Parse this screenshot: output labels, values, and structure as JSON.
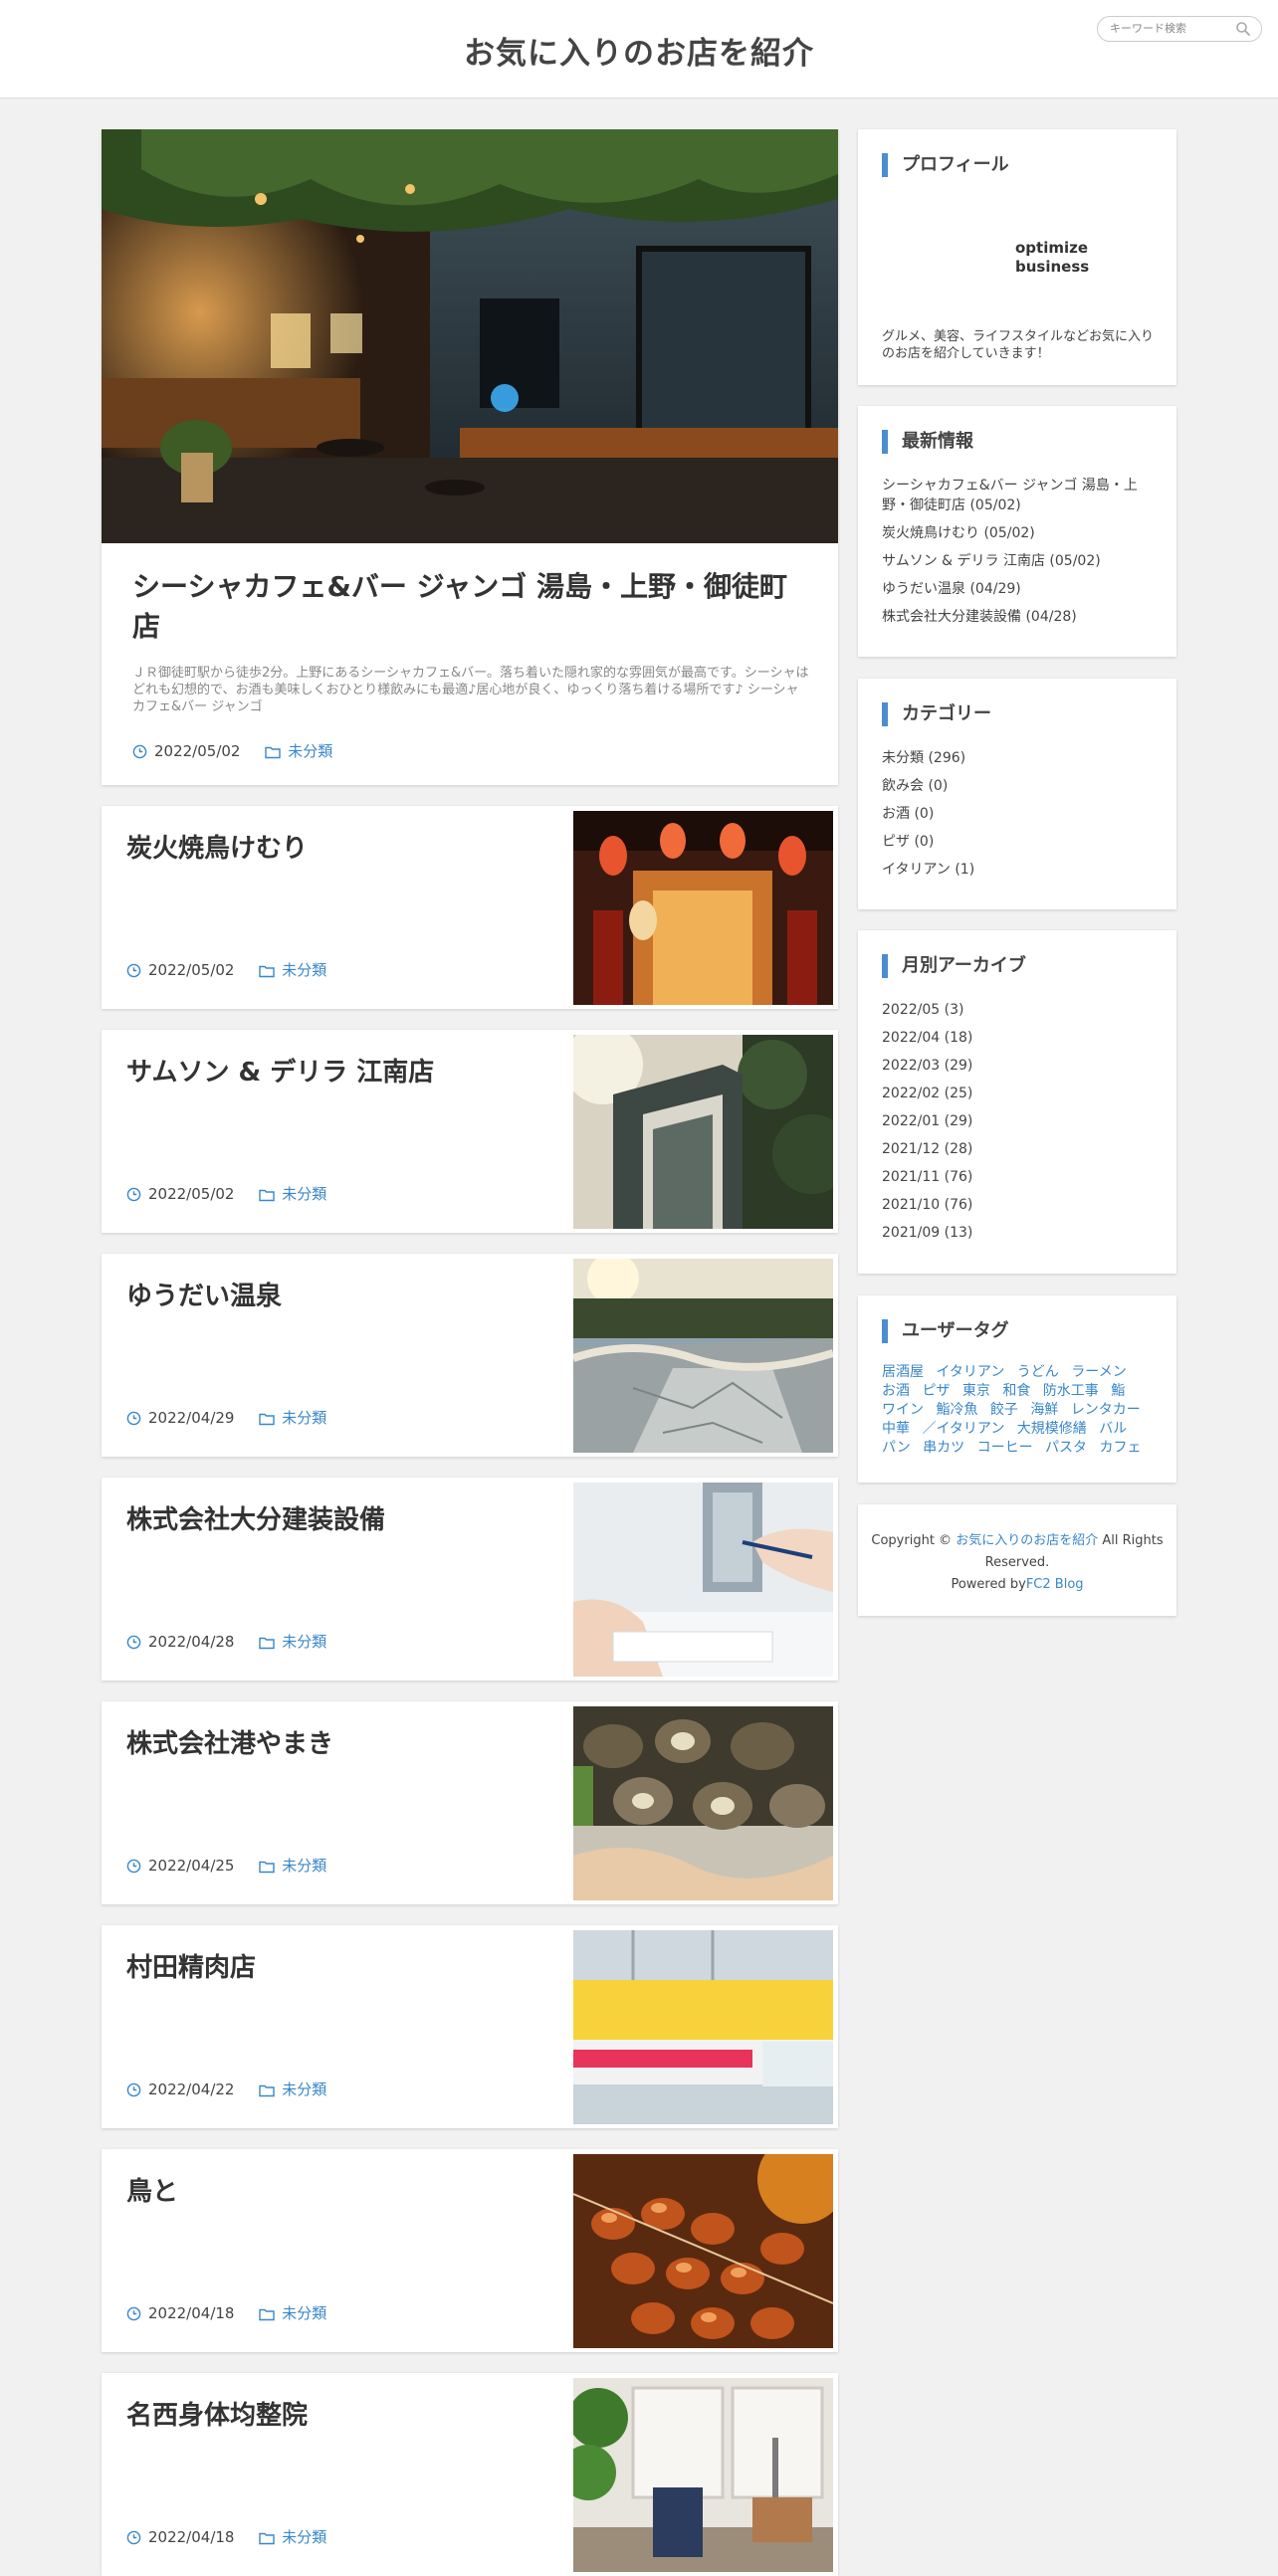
{
  "site": {
    "title": "お気に入りのお店を紹介"
  },
  "search": {
    "placeholder": "キーワード検索"
  },
  "featured": {
    "title": "シーシャカフェ&バー ジャンゴ 湯島・上野・御徒町店",
    "excerpt": "ＪＲ御徒町駅から徒歩2分。上野にあるシーシャカフェ&バー。落ち着いた隠れ家的な雰囲気が最高です。シーシャはどれも幻想的で、お酒も美味しくおひとり様飲みにも最適♪居心地が良く、ゆっくり落ち着ける場所です♪ シーシャカフェ&バー ジャンゴ",
    "date": "2022/05/02",
    "category": "未分類"
  },
  "posts": [
    {
      "title": "炭火焼鳥けむり",
      "date": "2022/05/02",
      "category": "未分類"
    },
    {
      "title": "サムソン & デリラ 江南店",
      "date": "2022/05/02",
      "category": "未分類"
    },
    {
      "title": "ゆうだい温泉",
      "date": "2022/04/29",
      "category": "未分類"
    },
    {
      "title": "株式会社大分建装設備",
      "date": "2022/04/28",
      "category": "未分類"
    },
    {
      "title": "株式会社港やまき",
      "date": "2022/04/25",
      "category": "未分類"
    },
    {
      "title": "村田精肉店",
      "date": "2022/04/22",
      "category": "未分類"
    },
    {
      "title": "鳥と",
      "date": "2022/04/18",
      "category": "未分類"
    },
    {
      "title": "名西身体均整院",
      "date": "2022/04/18",
      "category": "未分類"
    }
  ],
  "sidebar": {
    "profile": {
      "title": "プロフィール",
      "name": "optimize business",
      "description": "グルメ、美容、ライフスタイルなどお気に入りのお店を紹介していきます！"
    },
    "recent": {
      "title": "最新情報",
      "items": [
        "シーシャカフェ&バー ジャンゴ 湯島・上野・御徒町店 (05/02)",
        "炭火焼鳥けむり (05/02)",
        "サムソン & デリラ 江南店 (05/02)",
        "ゆうだい温泉 (04/29)",
        "株式会社大分建装設備 (04/28)"
      ]
    },
    "categories": {
      "title": "カテゴリー",
      "items": [
        "未分類 (296)",
        "飲み会 (0)",
        "お酒 (0)",
        "ピザ (0)",
        "イタリアン (1)"
      ]
    },
    "archives": {
      "title": "月別アーカイブ",
      "items": [
        "2022/05 (3)",
        "2022/04 (18)",
        "2022/03 (29)",
        "2022/02 (25)",
        "2022/01 (29)",
        "2021/12 (28)",
        "2021/11 (76)",
        "2021/10 (76)",
        "2021/09 (13)"
      ]
    },
    "tags": {
      "title": "ユーザータグ",
      "items": [
        "居酒屋",
        "イタリアン",
        "うどん",
        "ラーメン",
        "お酒",
        "ピザ",
        "東京",
        "和食",
        "防水工事",
        "鮨",
        "ワイン",
        "鮨冷魚",
        "餃子",
        "海鮮",
        "レンタカー",
        "中華",
        "／イタリアン",
        "大規模修繕",
        "バル",
        "パン",
        "串カツ",
        "コーヒー",
        "パスタ",
        "カフェ"
      ]
    },
    "footer": {
      "copyright": "Copyright ©",
      "site_link": "お気に入りのお店を紹介",
      "rights": "All Rights Reserved.",
      "powered_by": "Powered by",
      "fc2_link": "FC2 Blog"
    }
  },
  "colors": {
    "accent": "#3a87c9",
    "widget_bar": "#4a8dd0",
    "background": "#f1f1f1"
  }
}
